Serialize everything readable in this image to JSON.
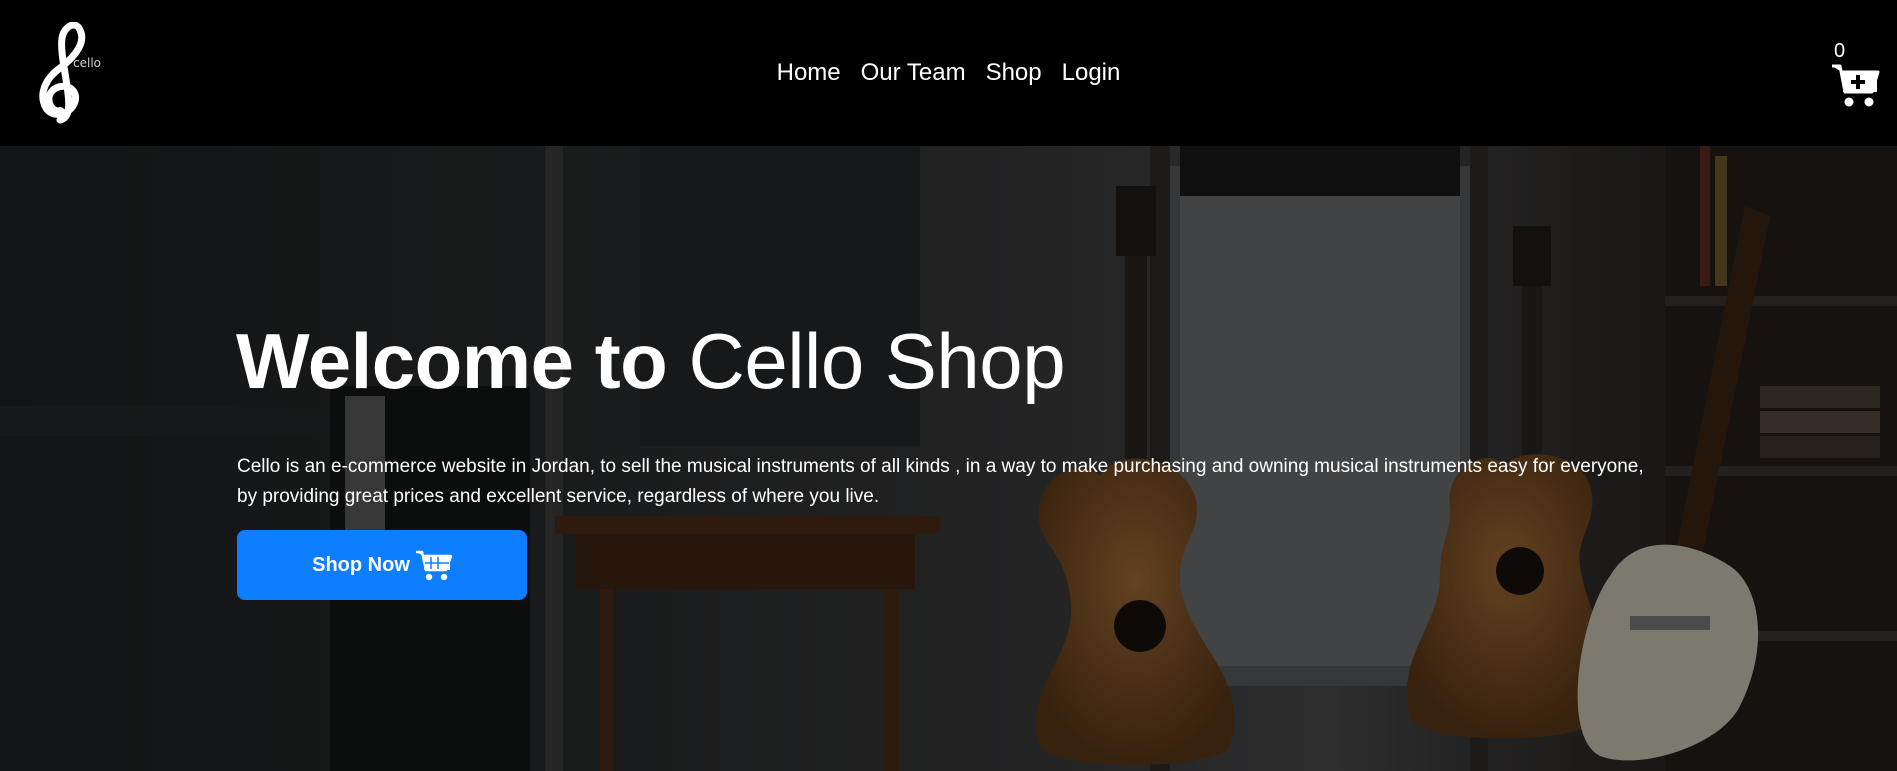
{
  "brand": {
    "logo_icon": "treble-clef-icon",
    "logo_text": "cello"
  },
  "nav": {
    "items": [
      {
        "label": "Home"
      },
      {
        "label": "Our Team"
      },
      {
        "label": "Shop"
      },
      {
        "label": "Login"
      }
    ]
  },
  "cart": {
    "count": "0",
    "icon": "cart-plus-icon"
  },
  "hero": {
    "title_bold": "Welcome to",
    "title_regular": "Cello Shop",
    "description": "Cello is an e-commerce website in Jordan, to sell the musical instruments of all kinds , in a way to make purchasing and owning musical instruments easy for everyone, by providing great prices and excellent service, regardless of where you live.",
    "button_label": "Shop Now",
    "button_icon": "shopping-cart-icon",
    "background": "guitar-studio-photo"
  },
  "colors": {
    "navbar": "#000000",
    "accent": "#0d7eff",
    "text": "#ffffff"
  }
}
